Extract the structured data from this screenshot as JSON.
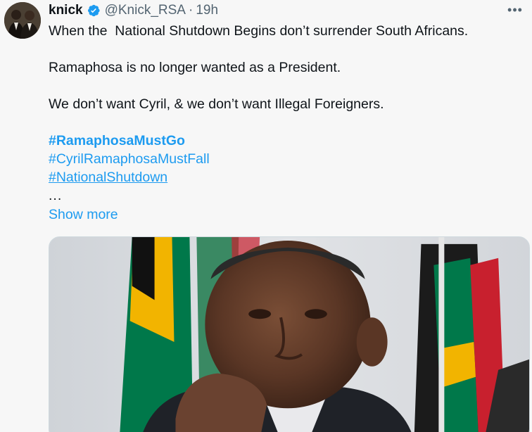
{
  "author": {
    "display_name": "knick",
    "handle": "@Knick_RSA",
    "separator": "·",
    "time": "19h",
    "verified": true
  },
  "icons": {
    "verified": "verified-badge-icon",
    "more": "more-options-icon"
  },
  "tweet": {
    "lines": [
      "When the  National Shutdown Begins don’t surrender South Africans.",
      "Ramaphosa is no longer wanted as a President.",
      "We don’t want Cyril, & we don’t want Illegal Foreigners."
    ],
    "hashtags": [
      "#RamaphosaMustGo",
      "#CyrilRamaphosaMustFall",
      "#NationalShutdown"
    ],
    "ellipsis": "...",
    "show_more": "Show more"
  },
  "colors": {
    "accent": "#1d9bf0",
    "text": "#0f1419",
    "secondary": "#536471",
    "background": "#f7f7f7"
  }
}
